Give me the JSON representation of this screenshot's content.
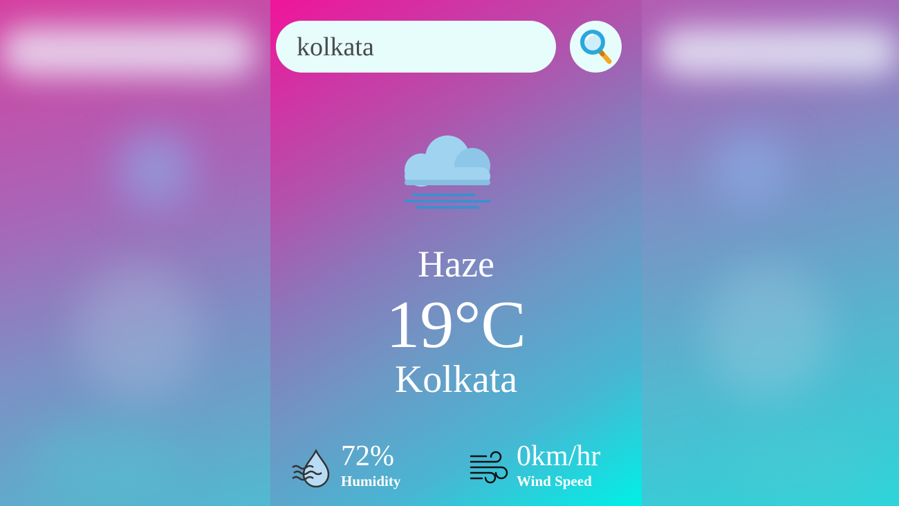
{
  "search": {
    "value": "kolkata",
    "button_icon": "search-icon"
  },
  "weather": {
    "icon": "haze-cloud-icon",
    "condition": "Haze",
    "temperature": "19°C",
    "city": "Kolkata"
  },
  "details": {
    "humidity": {
      "icon": "humidity-icon",
      "value": "72%",
      "label": "Humidity"
    },
    "wind": {
      "icon": "wind-icon",
      "value": "0km/hr",
      "label": "Wind Speed"
    }
  },
  "colors": {
    "card_top": "#f0149a",
    "card_bottom": "#00f0e6",
    "field_bg": "#e6fdfb",
    "cloud": "#9fd3f0",
    "haze_lines": "#3d8fd0"
  }
}
